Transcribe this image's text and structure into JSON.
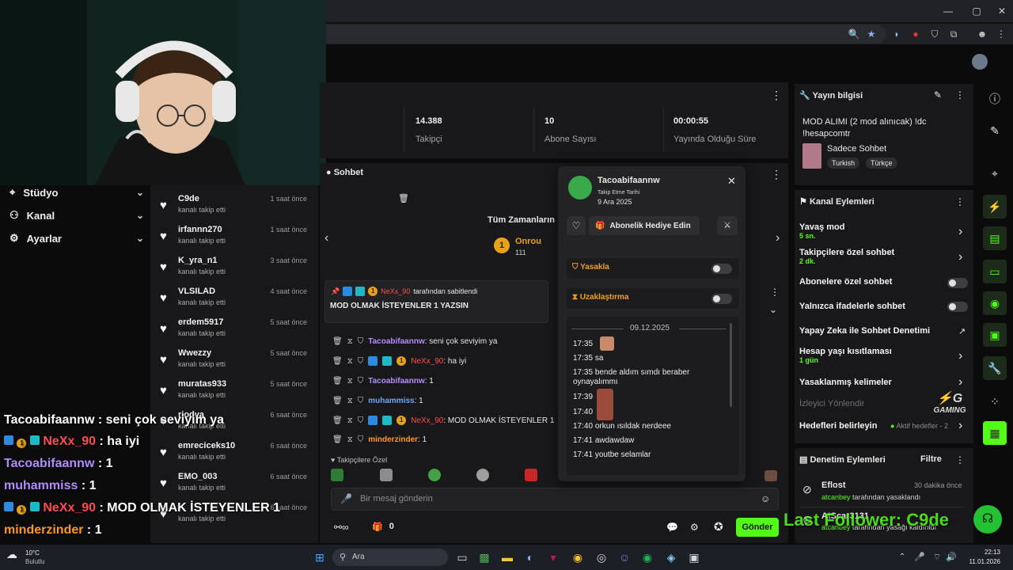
{
  "stats": [
    {
      "value": "14.388",
      "label": "Takipçi"
    },
    {
      "value": "10",
      "label": "Abone Sayısı"
    },
    {
      "value": "00:00:55",
      "label": "Yayında Olduğu Süre"
    }
  ],
  "nav": {
    "items": [
      {
        "label": "Stüdyo"
      },
      {
        "label": "Kanal"
      },
      {
        "label": "Ayarlar"
      }
    ]
  },
  "followers": [
    {
      "name": "C9de",
      "time": "1 saat önce",
      "action": "kanalı takip etti"
    },
    {
      "name": "irfannn270",
      "time": "1 saat önce",
      "action": "kanalı takip etti"
    },
    {
      "name": "K_yra_n1",
      "time": "3 saat önce",
      "action": "kanalı takip etti"
    },
    {
      "name": "VLSILAD",
      "time": "4 saat önce",
      "action": "kanalı takip etti"
    },
    {
      "name": "erdem5917",
      "time": "5 saat önce",
      "action": "kanalı takip etti"
    },
    {
      "name": "Wwezzy",
      "time": "5 saat önce",
      "action": "kanalı takip etti"
    },
    {
      "name": "muratas933",
      "time": "5 saat önce",
      "action": "kanalı takip etti"
    },
    {
      "name": "riodva",
      "time": "6 saat önce",
      "action": "kanalı takip etti"
    },
    {
      "name": "emreciceks10",
      "time": "6 saat önce",
      "action": "kanalı takip etti"
    },
    {
      "name": "EMO_003",
      "time": "6 saat önce",
      "action": "kanalı takip etti"
    },
    {
      "name": "",
      "time": "6 saat önce",
      "action": "kanalı takip etti"
    }
  ],
  "overlay_chat": [
    {
      "user": "Tacoabifaannw",
      "text": " : seni çok seviyim ya",
      "color": "#ffffff"
    },
    {
      "user": "NeXx_90",
      "text": " : ha iyi",
      "color": "#ff4d4d"
    },
    {
      "user": "Tacoabifaannw",
      "text": " : 1",
      "color": "#b48cff"
    },
    {
      "user": "muhammiss",
      "text": " : 1",
      "color": "#b48cff"
    },
    {
      "user": "NeXx_90",
      "text": " : MOD OLMAK İSTEYENLER 1",
      "color": "#ff4d4d"
    },
    {
      "user": "minderzinder",
      "text": " : 1",
      "color": "#ff9a1f"
    }
  ],
  "chat": {
    "title": "Sohbet",
    "all_time": "Tüm Zamanların",
    "top_user": "Onrou",
    "top_count": "111",
    "pinned_by_user": "NeXx_90",
    "pinned_by_suffix": "tarafından sabitlendi",
    "pinned_text": "MOD OLMAK İSTEYENLER 1 YAZSIN",
    "messages": [
      {
        "user": "Tacoabifaannw",
        "color": "#b48cff",
        "text": ": seni çok seviyim ya",
        "badges": false
      },
      {
        "user": "NeXx_90",
        "color": "#ff4d4d",
        "text": ": ha iyi",
        "badges": true
      },
      {
        "user": "Tacoabifaannw",
        "color": "#b48cff",
        "text": ": 1",
        "badges": false
      },
      {
        "user": "muhammiss",
        "color": "#6aa8ff",
        "text": ": 1",
        "badges": false
      },
      {
        "user": "NeXx_90",
        "color": "#ff4d4d",
        "text": ": MOD OLMAK İSTEYENLER 1",
        "badges": true
      },
      {
        "user": "minderzinder",
        "color": "#ff9a1f",
        "text": ": 1",
        "badges": false
      }
    ],
    "followers_only": "Takipçilere Özel",
    "input_placeholder": "Bir mesaj gönderin",
    "points": "0",
    "send_label": "Gönder"
  },
  "popup": {
    "username": "Tacoabifaannw",
    "follow_date_label": "Takip Etme Tarihi",
    "follow_date": "9 Ara 2025",
    "gift_label": "Abonelik Hediye Edin",
    "ban_label": "Yasakla",
    "timeout_label": "Uzaklaştırma",
    "date_divider": "09.12.2025",
    "log": [
      {
        "time": "17:35",
        "text": ""
      },
      {
        "time": "17:35",
        "text": "sa"
      },
      {
        "time": "17:35",
        "text": "bende aldım sımdı beraber oynayalımmı"
      },
      {
        "time": "17:39",
        "text": ""
      },
      {
        "time": "17:40",
        "text": ""
      },
      {
        "time": "17:40",
        "text": "orkun ısıldak nerdeee"
      },
      {
        "time": "17:41",
        "text": "awdawdaw"
      },
      {
        "time": "17:41",
        "text": "youtbe selamlar"
      }
    ]
  },
  "stream_info": {
    "title": "Yayın bilgisi",
    "stream_title": "MOD ALIMI (2 mod alınıcak) !dc !hesapcomtr",
    "category": "Sadece Sohbet",
    "tags": [
      "Turkish",
      "Türkçe"
    ]
  },
  "channel_actions": {
    "title": "Kanal Eylemleri",
    "items": [
      {
        "label": "Yavaş mod",
        "sub": "5 sn.",
        "control": "chevron"
      },
      {
        "label": "Takipçilere özel sohbet",
        "sub": "2 dk.",
        "control": "chevron"
      },
      {
        "label": "Abonelere özel sohbet",
        "sub": "",
        "control": "toggle"
      },
      {
        "label": "Yalnızca ifadelerle sohbet",
        "sub": "",
        "control": "toggle"
      },
      {
        "label": "Yapay Zeka ile Sohbet Denetimi",
        "sub": "",
        "control": "external"
      },
      {
        "label": "Hesap yaşı kısıtlaması",
        "sub": "1 gün",
        "control": "chevron"
      },
      {
        "label": "Yasaklanmış kelimeler",
        "sub": "",
        "control": "chevron"
      },
      {
        "label": "İzleyici Yönlendir",
        "sub": "",
        "control": "none"
      },
      {
        "label": "Hedefleri belirleyin",
        "sub": "",
        "control": "chevron"
      }
    ],
    "goals_status": "Aktif hedefler - 2"
  },
  "mod_actions": {
    "title": "Denetim Eylemleri",
    "filter": "Filtre",
    "entries": [
      {
        "user": "Eflost",
        "time": "30 dakika önce",
        "by": "atcanbey",
        "text": "tarafından yasaklandı"
      },
      {
        "user": "AtScar3131",
        "time": "",
        "by": "atcanbey",
        "text": "tarafından yasağı kaldırıldı"
      }
    ]
  },
  "overlay_last_follower": "Last Follower: C9de",
  "watermark": "GAMING",
  "taskbar": {
    "weather_temp": "10°C",
    "weather_desc": "Bulutlu",
    "search_placeholder": "Ara",
    "time": "22:13",
    "date": "11.01.2026"
  }
}
